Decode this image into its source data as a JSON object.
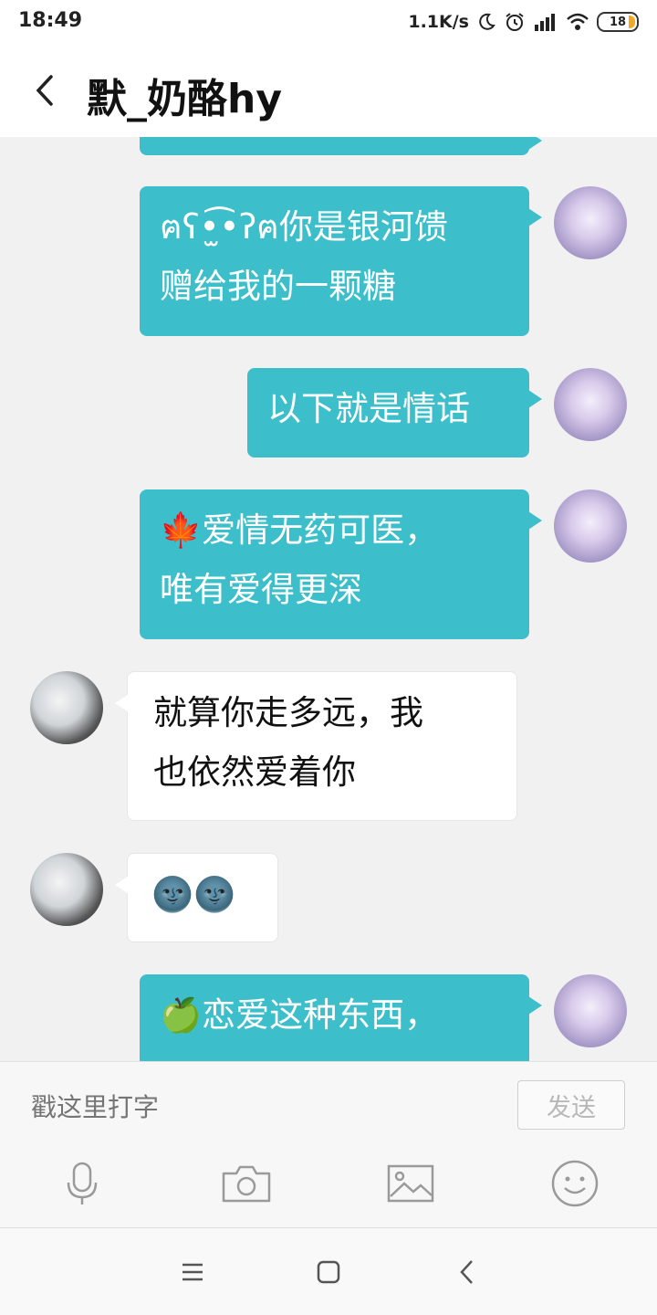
{
  "status_bar": {
    "time": "18:49",
    "net_speed": "1.1K/s",
    "battery_level": "18"
  },
  "header": {
    "title": "默_奶酪hy"
  },
  "messages": [
    {
      "side": "me",
      "text_lines": [
        "ฅʕ•̫͡•ʔฅ你是银河馈",
        "赠给我的一颗糖"
      ]
    },
    {
      "side": "me",
      "text_lines": [
        "以下就是情话"
      ]
    },
    {
      "side": "me",
      "text_lines": [
        "🍁爱情无药可医，",
        "唯有爱得更深"
      ]
    },
    {
      "side": "other",
      "text_lines": [
        "就算你走多远，我",
        "也依然爱着你"
      ]
    },
    {
      "side": "other",
      "text_lines": [
        "🌚🌚"
      ]
    },
    {
      "side": "me",
      "text_lines": [
        "🍏恋爱这种东西，"
      ]
    }
  ],
  "input": {
    "placeholder": "戳这里打字",
    "send_label": "发送"
  },
  "toolbar": {
    "icons": [
      "microphone-icon",
      "camera-icon",
      "image-icon",
      "emoji-icon"
    ]
  },
  "navbar": {
    "icons": [
      "menu-icon",
      "home-icon",
      "back-icon"
    ]
  },
  "colors": {
    "my_bubble": "#3cbfca",
    "other_bubble": "#ffffff",
    "chat_background": "#f1f1f1"
  }
}
